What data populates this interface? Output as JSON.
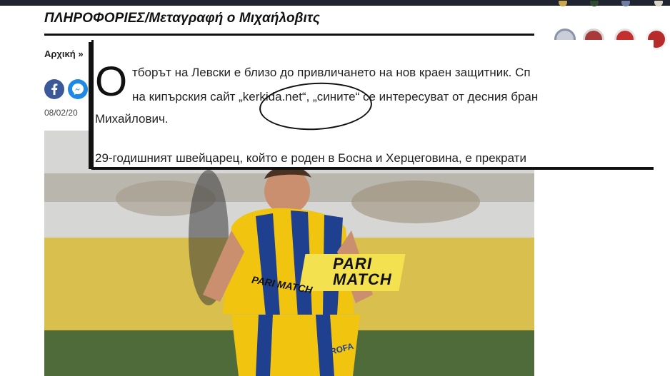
{
  "article": {
    "title": "ΠΛΗΡΟΦΟΡΙΕΣ/Μεταγραφή ο Μιχαήλοβιτς",
    "breadcrumb": "Αρχική",
    "breadcrumb_sep": "»",
    "date": "08/02/20"
  },
  "share": {
    "facebook_icon": "f",
    "messenger_icon": "messenger"
  },
  "callout": {
    "dropcap": "О",
    "line1": "тборът на Левски е близо до привличането на нов краен защитник. Сп",
    "line2": "на кипърския сайт „kerkida.net“, „сините“ се интересуват от десния бран",
    "line3": "Михайлович.",
    "line4": "29-годишният швейцарец, който е роден в Босна и Херцеговина, е прекрати"
  },
  "photo": {
    "sponsor_text": "PARI MATCH",
    "shirt_text": "PARI MATCH",
    "short_text": "PROFA"
  },
  "colors": {
    "facebook": "#3b5998",
    "messenger": "#1e88e5",
    "kit_yellow": "#f1c40f",
    "kit_blue": "#1f3f8f"
  }
}
